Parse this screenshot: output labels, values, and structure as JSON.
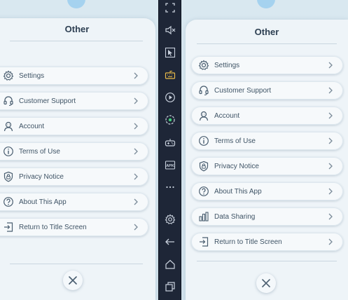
{
  "left_panel": {
    "title": "Other",
    "items": [
      {
        "label": "Settings",
        "icon": "gear-icon"
      },
      {
        "label": "Customer Support",
        "icon": "headset-icon"
      },
      {
        "label": "Account",
        "icon": "user-icon"
      },
      {
        "label": "Terms of Use",
        "icon": "info-icon"
      },
      {
        "label": "Privacy Notice",
        "icon": "shield-lock-icon"
      },
      {
        "label": "About This App",
        "icon": "question-icon"
      },
      {
        "label": "Return to Title Screen",
        "icon": "exit-icon"
      }
    ],
    "close_icon": "close-icon"
  },
  "right_panel": {
    "title": "Other",
    "items": [
      {
        "label": "Settings",
        "icon": "gear-icon"
      },
      {
        "label": "Customer Support",
        "icon": "headset-icon"
      },
      {
        "label": "Account",
        "icon": "user-icon"
      },
      {
        "label": "Terms of Use",
        "icon": "info-icon"
      },
      {
        "label": "Privacy Notice",
        "icon": "shield-lock-icon"
      },
      {
        "label": "About This App",
        "icon": "question-icon"
      },
      {
        "label": "Data Sharing",
        "icon": "bar-chart-icon"
      },
      {
        "label": "Return to Title Screen",
        "icon": "exit-icon"
      }
    ],
    "close_icon": "close-icon"
  },
  "toolbar": {
    "buttons": [
      {
        "name": "fullscreen-icon"
      },
      {
        "name": "mute-icon"
      },
      {
        "name": "cursor-icon"
      },
      {
        "name": "keyboard-icon"
      },
      {
        "name": "record-icon"
      },
      {
        "name": "location-icon"
      },
      {
        "name": "gamepad-icon"
      },
      {
        "name": "apk-icon",
        "text": "APK"
      },
      {
        "name": "more-icon"
      },
      {
        "name": "settings-icon"
      },
      {
        "name": "back-icon"
      },
      {
        "name": "home-icon"
      },
      {
        "name": "recent-apps-icon"
      }
    ]
  },
  "colors": {
    "background": "#d2e2ec",
    "panel": "#eef4f8",
    "text": "#3f5466",
    "title": "#2d3f52",
    "toolbar": "#1e2637",
    "toolbar_accent": "#e8b94a",
    "toolbar_green": "#3fd07a"
  }
}
